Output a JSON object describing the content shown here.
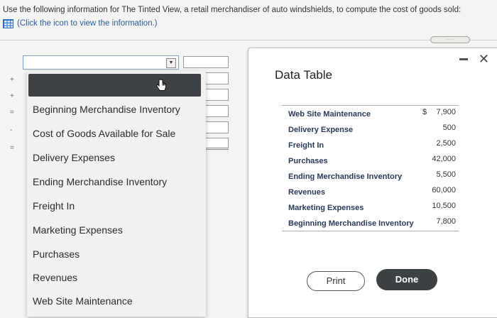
{
  "instructions": {
    "text": "Use the following information for The Tinted View, a retail merchandiser of auto windshields, to compute the cost of goods sold:",
    "link_text": "(Click the icon to view the information.)"
  },
  "handle": {
    "text": "....."
  },
  "row_signs": [
    "+",
    "+",
    "=",
    "-",
    "="
  ],
  "dropdown": {
    "items": [
      "Beginning Merchandise Inventory",
      "Cost of Goods Available for Sale",
      "Delivery Expenses",
      "Ending Merchandise Inventory",
      "Freight In",
      "Marketing Expenses",
      "Purchases",
      "Revenues",
      "Web Site Maintenance"
    ]
  },
  "data_table": {
    "title": "Data Table",
    "currency_symbol": "$",
    "rows": [
      {
        "label": "Web Site Maintenance",
        "value": "7,900"
      },
      {
        "label": "Delivery Expense",
        "value": "500"
      },
      {
        "label": "Freight In",
        "value": "2,500"
      },
      {
        "label": "Purchases",
        "value": "42,000"
      },
      {
        "label": "Ending Merchandise Inventory",
        "value": "5,500"
      },
      {
        "label": "Revenues",
        "value": "60,000"
      },
      {
        "label": "Marketing Expenses",
        "value": "10,500"
      },
      {
        "label": "Beginning Merchandise Inventory",
        "value": "7,800"
      }
    ],
    "close_glyph": "✕",
    "print_label": "Print",
    "done_label": "Done"
  }
}
